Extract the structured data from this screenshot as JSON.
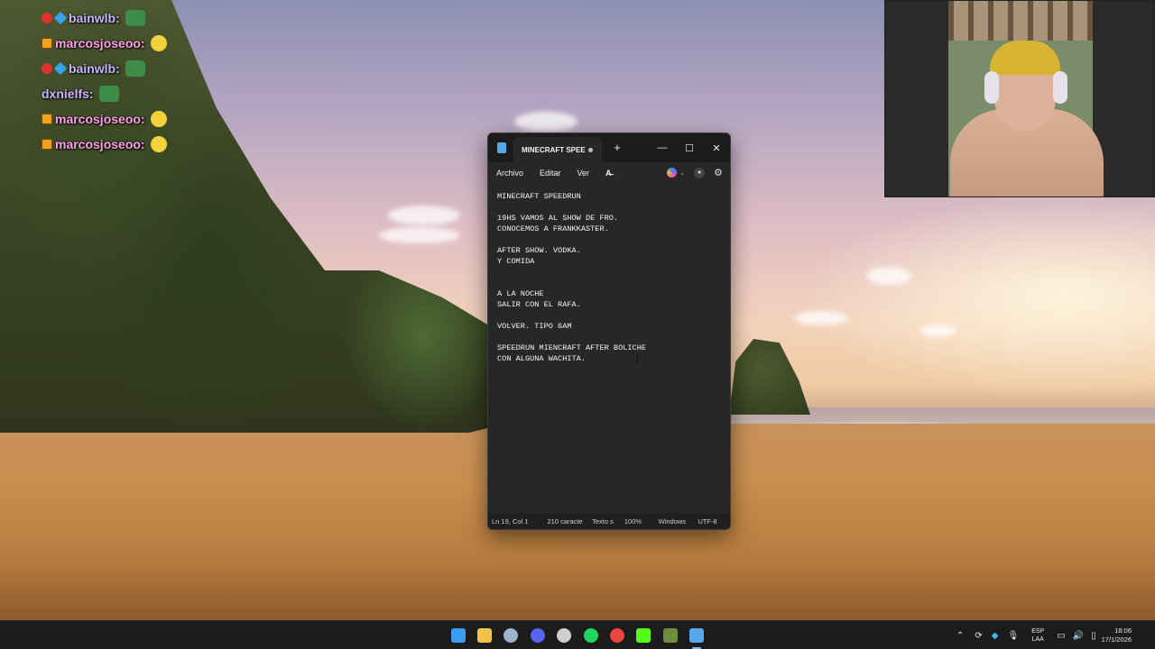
{
  "chat": {
    "messages": [
      {
        "user": "bainwlb:",
        "badges": [
          "red",
          "blue"
        ],
        "emote": "green"
      },
      {
        "user": "marcosjoseoo:",
        "badges": [
          "orange"
        ],
        "emote": "yellow"
      },
      {
        "user": "bainwlb:",
        "badges": [
          "red",
          "blue"
        ],
        "emote": "green"
      },
      {
        "user": "dxnielfs:",
        "badges": [],
        "emote": "green"
      },
      {
        "user": "marcosjoseoo:",
        "badges": [
          "orange"
        ],
        "emote": "yellow"
      },
      {
        "user": "marcosjoseoo:",
        "badges": [
          "orange"
        ],
        "emote": "yellow"
      }
    ]
  },
  "notepad": {
    "tab_title": "MINECRAFT SPEE",
    "new_tab_label": "+",
    "window_controls": {
      "minimize": "—",
      "maximize": "☐",
      "close": "✕"
    },
    "menu": {
      "file": "Archivo",
      "edit": "Editar",
      "view": "Ver",
      "format_icon": "A̶"
    },
    "icons": {
      "copilot": "copilot-icon",
      "account": "account-icon",
      "settings": "gear-icon"
    },
    "content": "MINECRAFT SPEEDRUN\n\n19HS VAMOS AL SHOW DE FRO.\nCONOCEMOS A FRANKKASTER.\n\nAFTER SHOW. VODKA.\nY COMIDA\n\n\nA LA NOCHE\nSALIR CON EL RAFA.\n\nVOLVER. TIPO 6AM\n\nSPEEDRUN MIENCRAFT AFTER BOLICHE\nCON ALGUNA WACHITA.",
    "status": {
      "position": "Ln 19, Col 1",
      "chars": "210 caracte",
      "format": "Texto s",
      "zoom": "100%",
      "line_ending": "Windows",
      "encoding": "UTF-8"
    }
  },
  "taskbar": {
    "apps": [
      {
        "name": "start-icon",
        "color": "#3a9cf2"
      },
      {
        "name": "file-explorer-icon",
        "color": "#f2c14a"
      },
      {
        "name": "steam-icon",
        "color": "#9ab3cf"
      },
      {
        "name": "discord-icon",
        "color": "#5865f2"
      },
      {
        "name": "obs-icon",
        "color": "#d0d0d0"
      },
      {
        "name": "spotify-icon",
        "color": "#1ed760"
      },
      {
        "name": "chrome-icon",
        "color": "#e8453c"
      },
      {
        "name": "kick-icon",
        "color": "#53fc18"
      },
      {
        "name": "minecraft-icon",
        "color": "#6b8e3a"
      },
      {
        "name": "notepad-icon",
        "color": "#56a8ea"
      }
    ],
    "tray": {
      "lang_line1": "ESP",
      "lang_line2": "LAA",
      "time": "18:06",
      "date": "17/1/2026"
    }
  }
}
